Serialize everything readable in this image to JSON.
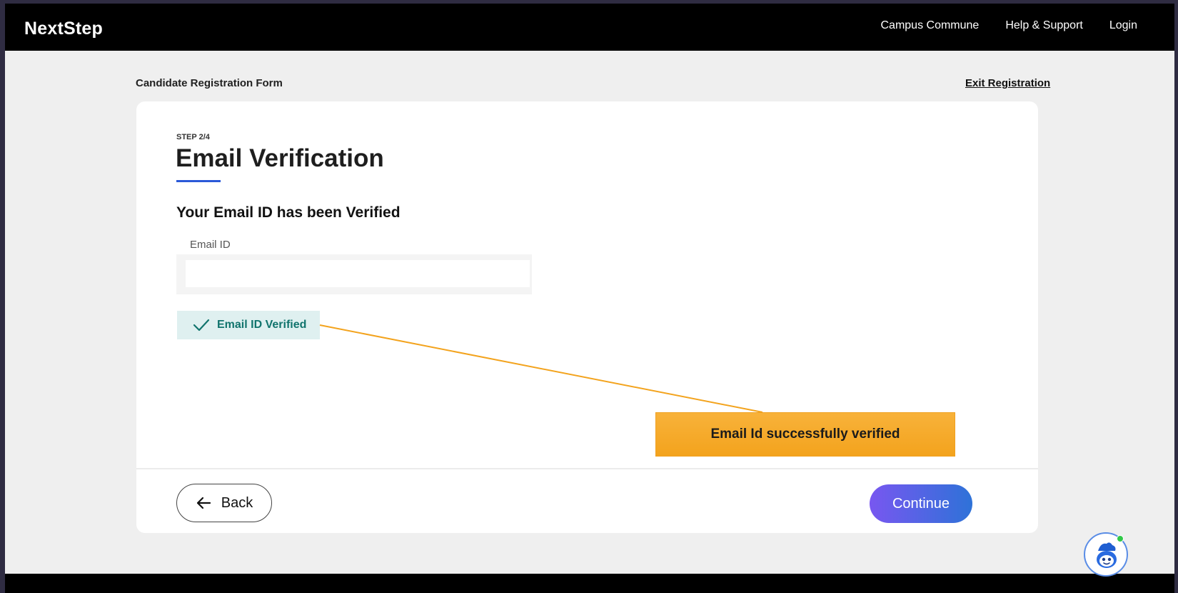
{
  "header": {
    "brand": "NextStep",
    "nav": [
      "Campus Commune",
      "Help & Support",
      "Login"
    ]
  },
  "page": {
    "form_title": "Candidate Registration Form",
    "exit_label": "Exit Registration"
  },
  "card": {
    "step": "STEP 2/4",
    "title": "Email Verification",
    "verified_heading": "Your Email ID has been Verified",
    "email_label": "Email ID",
    "email_value": "",
    "badge_label": "Email ID Verified",
    "back_label": "Back",
    "continue_label": "Continue"
  },
  "annotation": {
    "callout_text": "Email Id successfully verified"
  },
  "icons": {
    "check": "check-icon",
    "back_arrow": "arrow-left-icon",
    "chatbot": "chatbot-icon"
  },
  "colors": {
    "accent_blue": "#2b59d8",
    "badge_bg": "#dff0f0",
    "badge_text": "#11746d",
    "continue_gradient_start": "#7857f0",
    "continue_gradient_end": "#2e72d8",
    "callout_orange": "#f3a31d"
  }
}
